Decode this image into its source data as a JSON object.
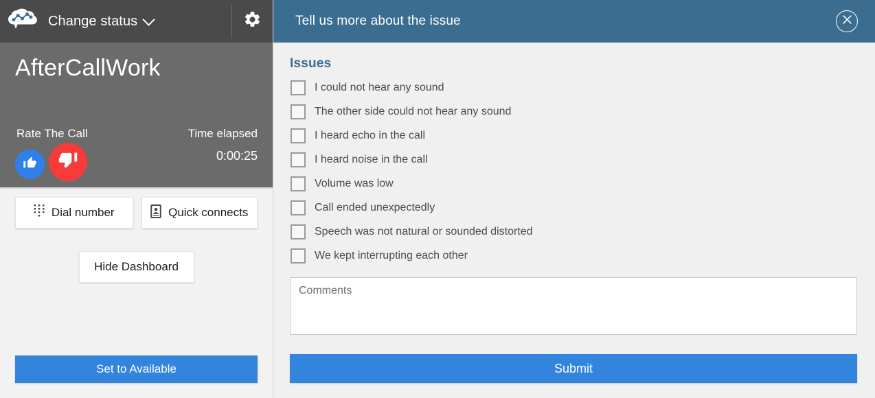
{
  "ccp": {
    "topbar": {
      "logo_icon": "cloud-analytics-logo",
      "status_label": "Change status",
      "chevron_icon": "chevron-down-icon",
      "settings_icon": "gear-icon"
    },
    "contact": {
      "state_name": "AfterCallWork",
      "rate_label": "Rate The Call",
      "elapsed_label": "Time elapsed",
      "elapsed_value": "0:00:25",
      "thumbs_up_icon": "thumbs-up-icon",
      "thumbs_down_icon": "thumbs-down-icon",
      "thumbs_up_color": "#2f80ed",
      "thumbs_down_color": "#f73a3a"
    },
    "actions": {
      "dial_icon": "dialpad-icon",
      "dial_label": "Dial number",
      "quick_icon": "contact-card-icon",
      "quick_label": "Quick connects",
      "hide_label": "Hide Dashboard"
    },
    "bottom": {
      "set_available_label": "Set to Available",
      "accent_color": "#3284dd"
    }
  },
  "issue_panel": {
    "header": {
      "title": "Tell us more about the issue",
      "close_icon": "close-circle-icon",
      "background_color": "#3a6d8f"
    },
    "section_title": "Issues",
    "section_title_color": "#3a6d8f",
    "issues": [
      {
        "label": "I could not hear any sound",
        "checked": false
      },
      {
        "label": "The other side could not hear any sound",
        "checked": false
      },
      {
        "label": "I heard echo in the call",
        "checked": false
      },
      {
        "label": "I heard noise in the call",
        "checked": false
      },
      {
        "label": "Volume was low",
        "checked": false
      },
      {
        "label": "Call ended unexpectedly",
        "checked": false
      },
      {
        "label": "Speech was not natural or sounded distorted",
        "checked": false
      },
      {
        "label": "We kept interrupting each other",
        "checked": false
      }
    ],
    "comments": {
      "placeholder": "Comments",
      "value": ""
    },
    "submit_label": "Submit",
    "submit_color": "#3284dd"
  }
}
